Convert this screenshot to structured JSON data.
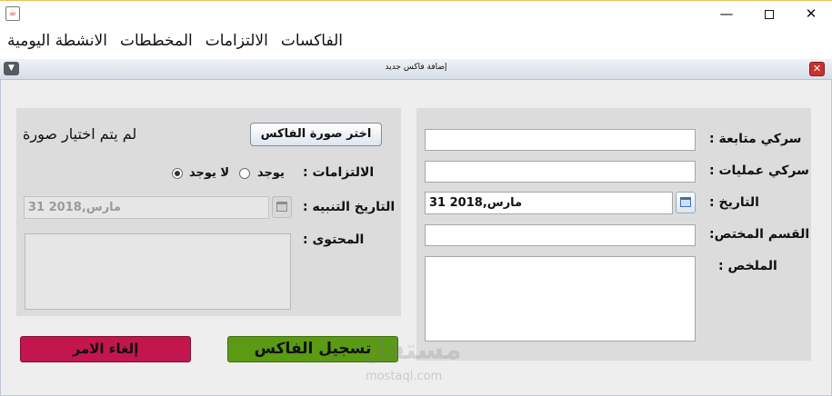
{
  "window": {
    "minimize_glyph": "—",
    "close_glyph": "✕"
  },
  "menubar": {
    "items": [
      "الانشطة اليومية",
      "المخططات",
      "الالتزامات",
      "الفاكسات"
    ]
  },
  "dialog": {
    "title": "إضافة فاكس جديد",
    "close_glyph": "✕",
    "menu_glyph": "▼"
  },
  "right_panel": {
    "follow_secretary_label": "سركي متابعة :",
    "follow_secretary_value": "",
    "operations_secretary_label": "سركي عمليات :",
    "operations_secretary_value": "",
    "date_label": "التاريخ :",
    "date_value": "مارس,2018 31",
    "department_label": "القسم المختص:",
    "department_value": "",
    "summary_label": "الملخص :",
    "summary_value": ""
  },
  "left_panel": {
    "choose_image_button": "اختر صورة الفاكس",
    "no_image_text": "لم يتم اختيار صورة",
    "commitments_label": "الالتزامات :",
    "radio_exists": "يوجد",
    "radio_not_exists": "لا يوجد",
    "radio_selected": "لا يوجد",
    "reminder_date_label": "التاريخ التنبيه :",
    "reminder_date_value": "مارس,2018 31",
    "content_label": "المحتوى :",
    "content_value": ""
  },
  "actions": {
    "save_button": "تسجيل الفاكس",
    "cancel_button": "إلغاء الامر"
  },
  "watermark": {
    "text": "مستقل",
    "sub": "mostaql.com"
  },
  "colors": {
    "save": "#5a9a14",
    "cancel": "#c3164e",
    "close": "#c9322c"
  }
}
